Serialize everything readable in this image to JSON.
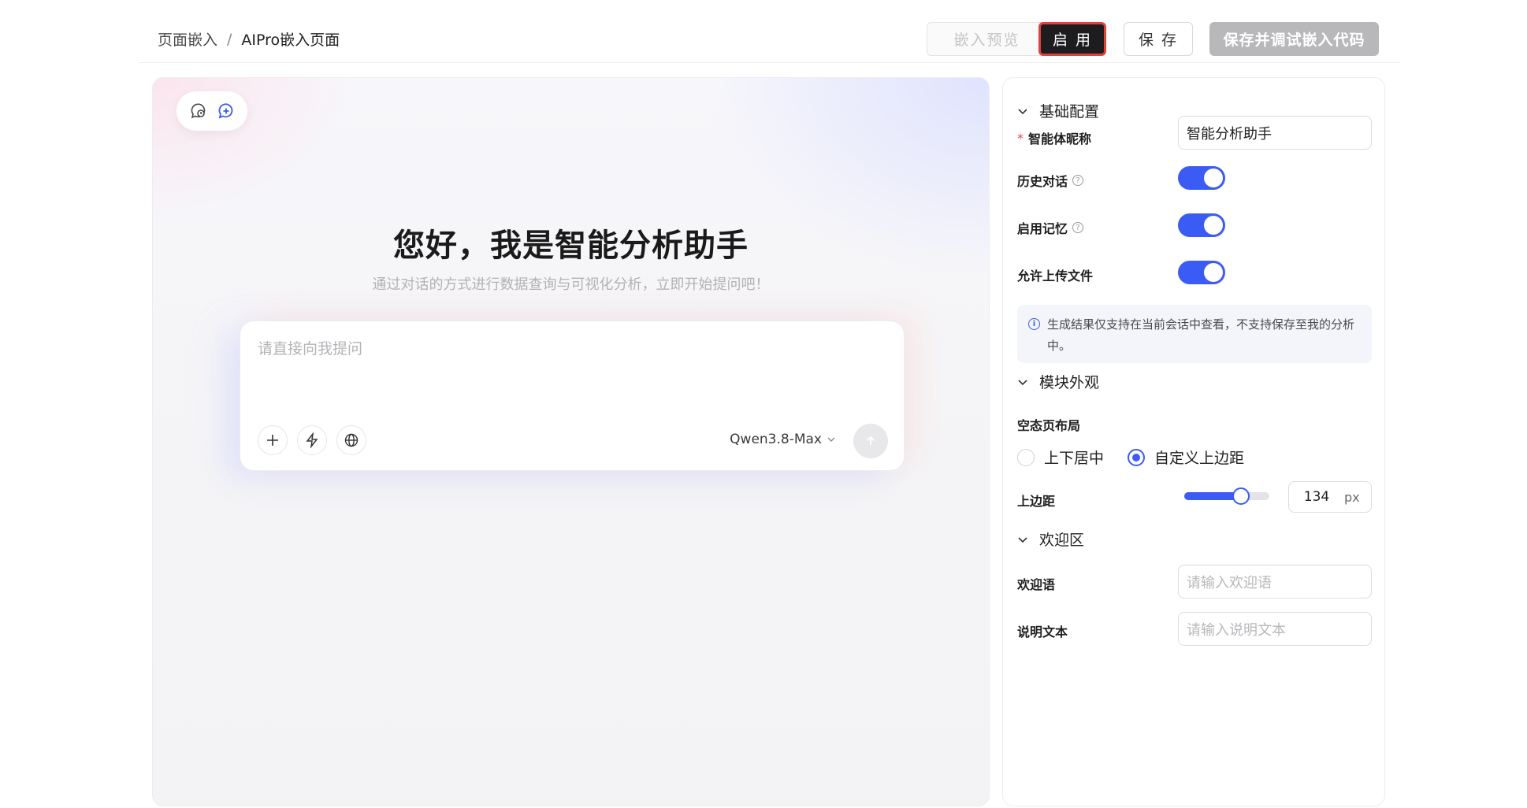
{
  "header": {
    "breadcrumb": [
      "页面嵌入",
      "AIPro嵌入页面"
    ],
    "separator": "/",
    "buttons": {
      "preview": "嵌入预览",
      "enable": "启 用",
      "save": "保 存",
      "save_debug": "保存并调试嵌入代码"
    }
  },
  "preview": {
    "title": "您好，我是智能分析助手",
    "subtitle": "通过对话的方式进行数据查询与可视化分析，立即开始提问吧！",
    "input_placeholder": "请直接向我提问",
    "model": "Qwen3.8-Max"
  },
  "panel": {
    "basic": {
      "title": "基础配置",
      "nickname_label": "智能体昵称",
      "nickname_value": "智能分析助手",
      "history_label": "历史对话",
      "memory_label": "启用记忆",
      "upload_label": "允许上传文件",
      "history_on": true,
      "memory_on": true,
      "upload_on": true,
      "notice": "生成结果仅支持在当前会话中查看，不支持保存至我的分析中。"
    },
    "appearance": {
      "title": "模块外观",
      "layout_label": "空态页布局",
      "option_center": "上下居中",
      "option_custom": "自定义上边距",
      "selected": "自定义上边距",
      "margin_label": "上边距",
      "margin_value": "134",
      "margin_unit": "px",
      "slider_fraction": 0.67
    },
    "welcome": {
      "title": "欢迎区",
      "greeting_label": "欢迎语",
      "greeting_placeholder": "请输入欢迎语",
      "desc_label": "说明文本",
      "desc_placeholder": "请输入说明文本"
    }
  },
  "colors": {
    "accent": "#3b5bf5",
    "highlight_border": "#e0413b"
  }
}
